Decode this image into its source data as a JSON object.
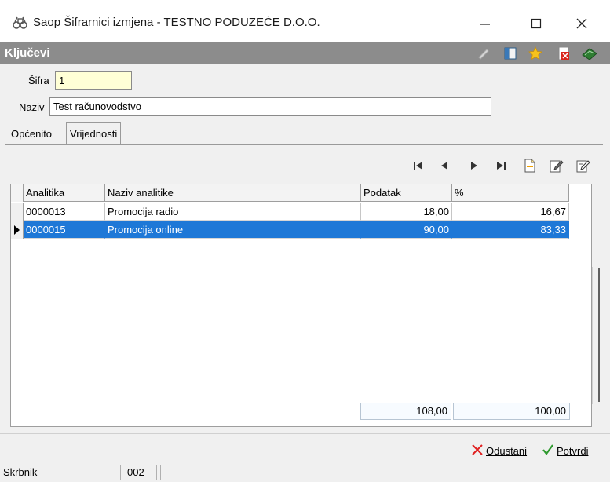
{
  "window": {
    "title": "Saop Šifrarnici izmjena  - TESTNO PODUZEĆE D.O.O."
  },
  "header": {
    "title": "Ključevi",
    "toolbar_icons": [
      "pencil-check-icon",
      "columns-icon",
      "star-icon",
      "close-document-icon",
      "book-exit-icon"
    ]
  },
  "form": {
    "sifra_label": "Šifra",
    "sifra_value": "1",
    "naziv_label": "Naziv",
    "naziv_value": "Test računovodstvo"
  },
  "tabs": [
    {
      "label": "Općenito",
      "active": false
    },
    {
      "label": "Vrijednosti",
      "active": true
    }
  ],
  "nav_icons": [
    "first-record-icon",
    "prev-record-icon",
    "next-record-icon",
    "last-record-icon",
    "new-record-icon",
    "edit-record-icon",
    "edit-all-icon"
  ],
  "grid": {
    "columns": [
      "Analitika",
      "Naziv analitike",
      "Podatak",
      "%"
    ],
    "rows": [
      {
        "analitika": "0000013",
        "naziv": "Promocija radio",
        "podatak": "18,00",
        "pct": "16,67",
        "selected": false
      },
      {
        "analitika": "0000015",
        "naziv": "Promocija online",
        "podatak": "90,00",
        "pct": "83,33",
        "selected": true
      }
    ],
    "total_podatak": "108,00",
    "total_pct": "100,00"
  },
  "actions": {
    "cancel_label": "Odustani",
    "confirm_label": "Potvrdi"
  },
  "status": {
    "user": "Skrbnik",
    "code": "002"
  },
  "colors": {
    "selection": "#1e78d7",
    "header_strip": "#8c8c8c",
    "sifra_bg": "#ffffd6"
  }
}
